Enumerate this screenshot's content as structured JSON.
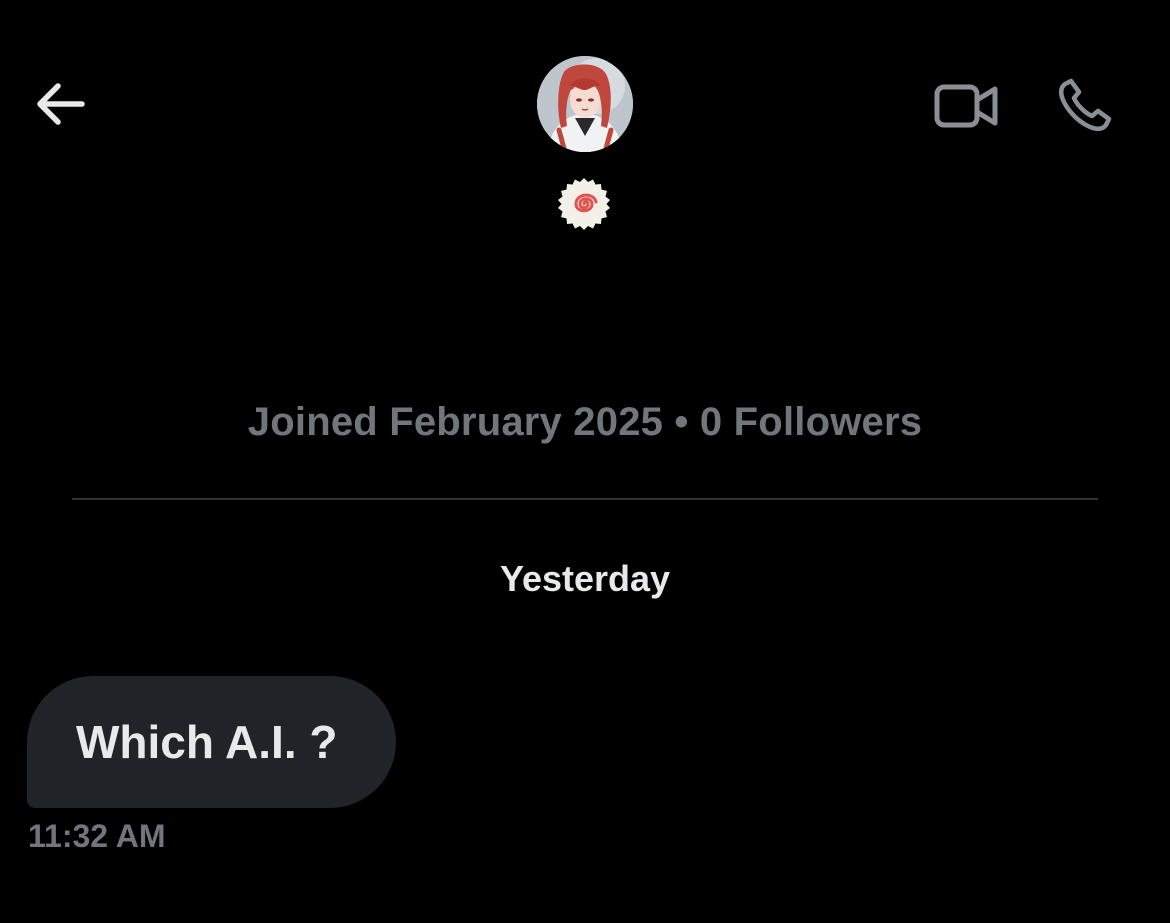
{
  "header": {
    "back_icon": "arrow-left-icon",
    "video_icon": "video-camera-icon",
    "call_icon": "phone-icon",
    "badge_icon": "narutomaki-badge-icon"
  },
  "profile": {
    "meta": "Joined February 2025 • 0 Followers"
  },
  "conversation": {
    "date_label": "Yesterday",
    "messages": [
      {
        "text": "Which A.I. ?",
        "time": "11:32 AM",
        "direction": "received"
      }
    ]
  },
  "colors": {
    "background": "#000000",
    "primary_text": "#e7e9ea",
    "secondary_text": "#71767b",
    "divider": "#2f3336",
    "bubble_received": "#202327",
    "icon_stroke": "#e7e9ea",
    "icon_stroke_secondary": "#8b8f94"
  }
}
